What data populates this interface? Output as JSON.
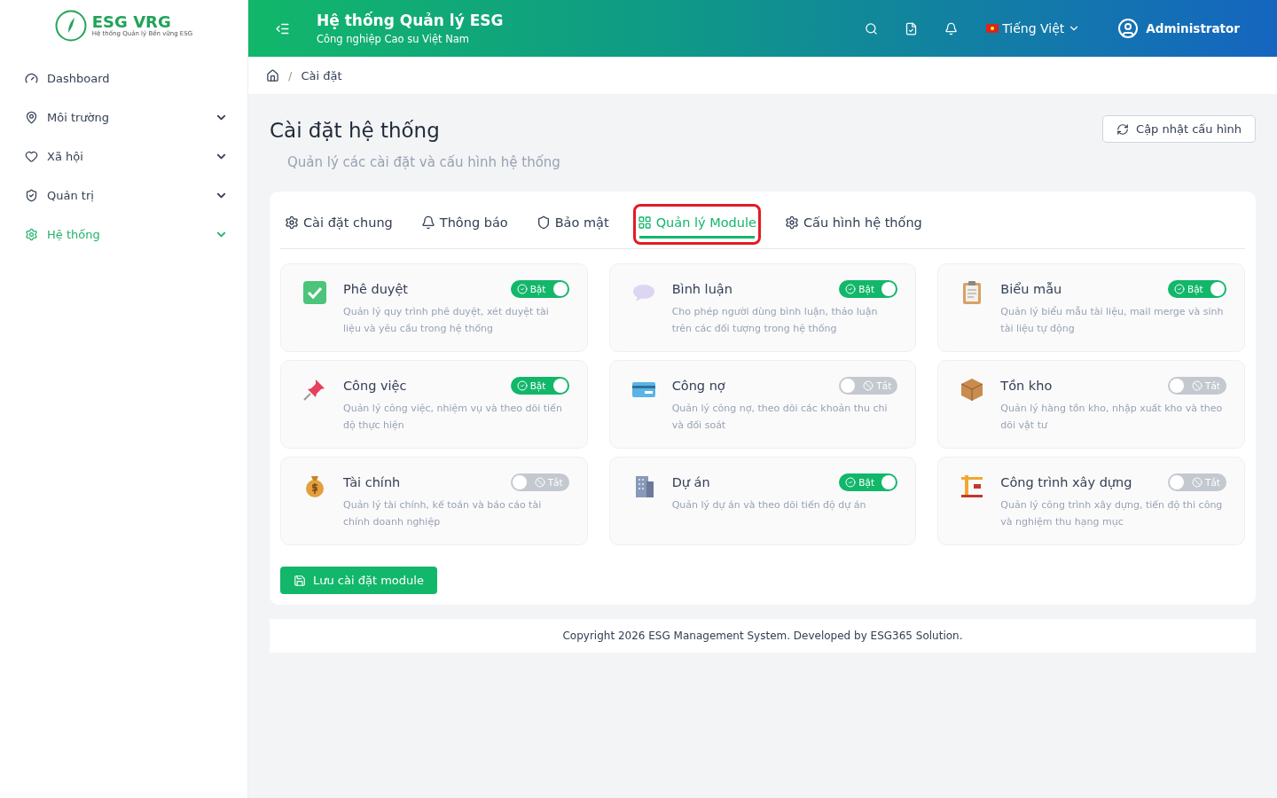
{
  "logo": {
    "title": "ESG VRG",
    "subtitle": "Hệ thống Quản lý Bền vững ESG"
  },
  "sidebar": {
    "items": [
      {
        "label": "Dashboard",
        "selected": false,
        "expandable": false
      },
      {
        "label": "Môi trường",
        "selected": false,
        "expandable": true
      },
      {
        "label": "Xã hội",
        "selected": false,
        "expandable": true
      },
      {
        "label": "Quản trị",
        "selected": false,
        "expandable": true
      },
      {
        "label": "Hệ thống",
        "selected": true,
        "expandable": true
      }
    ]
  },
  "header": {
    "title": "Hệ thống Quản lý ESG",
    "subtitle": "Công nghiệp Cao su Việt Nam",
    "language": "Tiếng Việt",
    "user": "Administrator"
  },
  "breadcrumb": {
    "separator": "/",
    "items": [
      "Cài đặt"
    ]
  },
  "page": {
    "title": "Cài đặt hệ thống",
    "subtitle": "Quản lý các cài đặt và cấu hình hệ thống",
    "refresh_button": "Cập nhật cấu hình"
  },
  "tabs": [
    {
      "label": "Cài đặt chung",
      "selected": false,
      "highlighted": false
    },
    {
      "label": "Thông báo",
      "selected": false,
      "highlighted": false
    },
    {
      "label": "Bảo mật",
      "selected": false,
      "highlighted": false
    },
    {
      "label": "Quản lý Module",
      "selected": true,
      "highlighted": true
    },
    {
      "label": "Cấu hình hệ thống",
      "selected": false,
      "highlighted": false
    }
  ],
  "modules": [
    {
      "name": "Phê duyệt",
      "description": "Quản lý quy trình phê duyệt, xét duyệt tài liệu và yêu cầu trong hệ thống",
      "on": true,
      "toggle_label": "Bật"
    },
    {
      "name": "Bình luận",
      "description": "Cho phép người dùng bình luận, thảo luận trên các đối tượng trong hệ thống",
      "on": true,
      "toggle_label": "Bật"
    },
    {
      "name": "Biểu mẫu",
      "description": "Quản lý biểu mẫu tài liệu, mail merge và sinh tài liệu tự động",
      "on": true,
      "toggle_label": "Bật"
    },
    {
      "name": "Công việc",
      "description": "Quản lý công việc, nhiệm vụ và theo dõi tiến độ thực hiện",
      "on": true,
      "toggle_label": "Bật"
    },
    {
      "name": "Công nợ",
      "description": "Quản lý công nợ, theo dõi các khoản thu chi và đối soát",
      "on": false,
      "toggle_label": "Tắt"
    },
    {
      "name": "Tồn kho",
      "description": "Quản lý hàng tồn kho, nhập xuất kho và theo dõi vật tư",
      "on": false,
      "toggle_label": "Tắt"
    },
    {
      "name": "Tài chính",
      "description": "Quản lý tài chính, kế toán và báo cáo tài chính doanh nghiệp",
      "on": false,
      "toggle_label": "Tắt"
    },
    {
      "name": "Dự án",
      "description": "Quản lý dự án và theo dõi tiến độ dự án",
      "on": true,
      "toggle_label": "Bật"
    },
    {
      "name": "Công trình xây dựng",
      "description": "Quản lý công trình xây dựng, tiến độ thi công và nghiệm thu hạng mục",
      "on": false,
      "toggle_label": "Tắt"
    }
  ],
  "save_button": "Lưu cài đặt module",
  "footer": "Copyright 2026 ESG Management System. Developed by ESG365 Solution."
}
